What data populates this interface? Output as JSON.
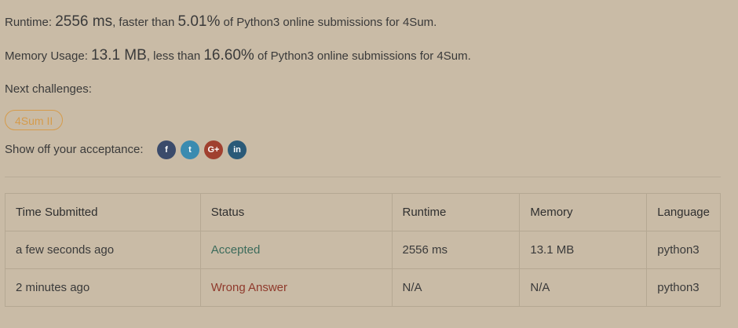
{
  "runtime_summary": {
    "prefix": "Runtime: ",
    "value": "2556 ms",
    "mid": ", faster than ",
    "percent": "5.01%",
    "suffix": " of Python3 online submissions for 4Sum."
  },
  "memory_summary": {
    "prefix": "Memory Usage: ",
    "value": "13.1 MB",
    "mid": ", less than ",
    "percent": "16.60%",
    "suffix": " of Python3 online submissions for 4Sum."
  },
  "next_challenges": {
    "label": "Next challenges:",
    "items": [
      "4Sum II"
    ]
  },
  "share": {
    "label": "Show off your acceptance:",
    "buttons": [
      {
        "icon": "facebook-icon",
        "glyph": "f",
        "color": "#3b4b6b"
      },
      {
        "icon": "twitter-icon",
        "glyph": "t",
        "color": "#3a8bb0"
      },
      {
        "icon": "google-plus-icon",
        "glyph": "G+",
        "color": "#a0402f"
      },
      {
        "icon": "linkedin-icon",
        "glyph": "in",
        "color": "#2a5a78"
      }
    ]
  },
  "submissions": {
    "headers": [
      "Time Submitted",
      "Status",
      "Runtime",
      "Memory",
      "Language"
    ],
    "rows": [
      {
        "time": "a few seconds ago",
        "status": "Accepted",
        "runtime": "2556 ms",
        "memory": "13.1 MB",
        "language": "python3"
      },
      {
        "time": "2 minutes ago",
        "status": "Wrong Answer",
        "runtime": "N/A",
        "memory": "N/A",
        "language": "python3"
      }
    ]
  },
  "colors": {
    "background": "#c9bba6",
    "accepted": "#3c6b5b",
    "wrong_answer": "#8f3a2c",
    "chip": "#d59b4b"
  }
}
